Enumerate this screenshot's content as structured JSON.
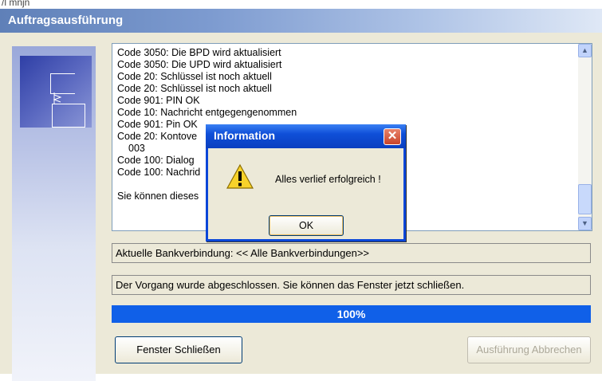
{
  "top_fragment": "/l mnjn",
  "window": {
    "title": "Auftragsausführung"
  },
  "log": {
    "lines": [
      "Code 3050: Die BPD wird aktualisiert",
      "Code 3050: Die UPD wird aktualisiert",
      "Code 20: Schlüssel ist noch aktuell",
      "Code 20: Schlüssel ist noch aktuell",
      "Code 901: PIN OK",
      "Code 10: Nachricht entgegengenommen",
      "Code 901: Pin OK",
      "Code 20: Kontove",
      "003",
      "Code 100: Dialog",
      "Code 100: Nachrid",
      "",
      "Sie können dieses"
    ]
  },
  "status": {
    "bank_line": "Aktuelle Bankverbindung: << Alle Bankverbindungen>>",
    "completion_line": "Der Vorgang wurde abgeschlossen. Sie können das Fenster jetzt schließen."
  },
  "progress": {
    "percent": 100,
    "label": "100%"
  },
  "buttons": {
    "close_label": "Fenster Schließen",
    "abort_label": "Ausführung Abbrechen"
  },
  "dialog": {
    "title": "Information",
    "message": "Alles verlief erfolgreich !",
    "ok_label": "OK",
    "icon": "warning-icon",
    "close_icon": "close-icon"
  },
  "colors": {
    "titlebar_start": "#5f80b8",
    "progress_fill": "#1060e8",
    "dialog_title": "#0f4fd8",
    "dialog_close": "#c9442a"
  }
}
